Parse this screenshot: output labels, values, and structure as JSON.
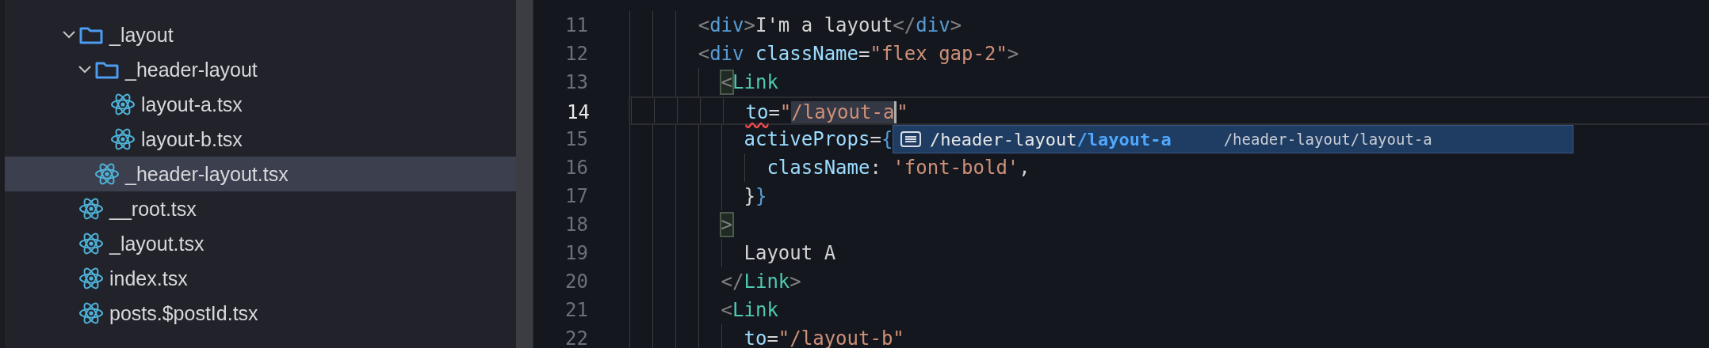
{
  "sidebar": {
    "tree": [
      {
        "kind": "folder",
        "label": "_layout",
        "expanded": true,
        "selected": false,
        "children": [
          {
            "kind": "folder",
            "label": "_header-layout",
            "expanded": true,
            "selected": false,
            "children": [
              {
                "kind": "react",
                "label": "layout-a.tsx",
                "selected": false
              },
              {
                "kind": "react",
                "label": "layout-b.tsx",
                "selected": false
              }
            ]
          },
          {
            "kind": "react",
            "label": "_header-layout.tsx",
            "selected": true
          }
        ]
      },
      {
        "kind": "react",
        "label": "__root.tsx",
        "selected": false
      },
      {
        "kind": "react",
        "label": "_layout.tsx",
        "selected": false
      },
      {
        "kind": "react",
        "label": "index.tsx",
        "selected": false
      },
      {
        "kind": "react",
        "label": "posts.$postId.tsx",
        "selected": false
      }
    ]
  },
  "editor": {
    "lines": [
      {
        "number": "11",
        "current": false,
        "tokens": [
          {
            "kind": "punct",
            "text": "      <"
          },
          {
            "kind": "tag",
            "text": "div"
          },
          {
            "kind": "punct",
            "text": ">"
          },
          {
            "kind": "text",
            "text": "I'm a layout"
          },
          {
            "kind": "punct",
            "text": "</"
          },
          {
            "kind": "tag",
            "text": "div"
          },
          {
            "kind": "punct",
            "text": ">"
          }
        ]
      },
      {
        "number": "12",
        "current": false,
        "tokens": [
          {
            "kind": "punct",
            "text": "      <"
          },
          {
            "kind": "tag",
            "text": "div"
          },
          {
            "kind": "attr",
            "text": " className"
          },
          {
            "kind": "text",
            "text": "="
          },
          {
            "kind": "string",
            "text": "\"flex gap-2\""
          },
          {
            "kind": "punct",
            "text": ">"
          }
        ]
      },
      {
        "number": "13",
        "current": false,
        "tokens": [
          {
            "kind": "punct",
            "text": "        <",
            "matched": true
          },
          {
            "kind": "component",
            "text": "Link"
          }
        ]
      },
      {
        "number": "14",
        "current": true,
        "tokens": [
          {
            "kind": "attr",
            "text": "          to",
            "error": true
          },
          {
            "kind": "text",
            "text": "="
          },
          {
            "kind": "string",
            "text": "\""
          },
          {
            "kind": "string",
            "text": "/layout-a",
            "selected": true,
            "caret": true
          },
          {
            "kind": "string",
            "text": "\""
          }
        ]
      },
      {
        "number": "15",
        "current": false,
        "tokens": [
          {
            "kind": "attr",
            "text": "          activeProps"
          },
          {
            "kind": "text",
            "text": "="
          },
          {
            "kind": "brace",
            "text": "{"
          }
        ]
      },
      {
        "number": "16",
        "current": false,
        "tokens": [
          {
            "kind": "attr",
            "text": "            className"
          },
          {
            "kind": "text",
            "text": ": "
          },
          {
            "kind": "string",
            "text": "'font-bold'"
          },
          {
            "kind": "text",
            "text": ","
          }
        ]
      },
      {
        "number": "17",
        "current": false,
        "tokens": [
          {
            "kind": "text",
            "text": "          }"
          },
          {
            "kind": "brace",
            "text": "}"
          }
        ]
      },
      {
        "number": "18",
        "current": false,
        "tokens": [
          {
            "kind": "punct",
            "text": "        >",
            "matched": true
          }
        ]
      },
      {
        "number": "19",
        "current": false,
        "tokens": [
          {
            "kind": "text",
            "text": "          Layout A"
          }
        ]
      },
      {
        "number": "20",
        "current": false,
        "tokens": [
          {
            "kind": "punct",
            "text": "        </"
          },
          {
            "kind": "component",
            "text": "Link"
          },
          {
            "kind": "punct",
            "text": ">"
          }
        ]
      },
      {
        "number": "21",
        "current": false,
        "tokens": [
          {
            "kind": "punct",
            "text": "        <"
          },
          {
            "kind": "component",
            "text": "Link"
          }
        ]
      },
      {
        "number": "22",
        "current": false,
        "tokens": [
          {
            "kind": "attr",
            "text": "          to"
          },
          {
            "kind": "text",
            "text": "="
          },
          {
            "kind": "string",
            "text": "\"/layout-b\""
          }
        ]
      }
    ],
    "suggestion": {
      "label": "/header-layout**/layout-a**",
      "detail": "/header-layout/layout-a"
    }
  }
}
